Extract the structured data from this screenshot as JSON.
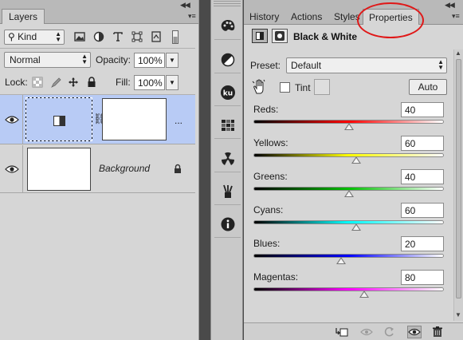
{
  "layers_panel": {
    "tab_label": "Layers",
    "collapse_glyph": "◀◀",
    "menu_glyph": "▾≡",
    "filter": {
      "label": "Kind",
      "icons": [
        "image-filter-icon",
        "adjustment-filter-icon",
        "type-filter-icon",
        "shape-filter-icon",
        "smart-object-filter-icon",
        "filter-toggle-icon"
      ]
    },
    "blend_mode": "Normal",
    "opacity_label": "Opacity:",
    "opacity_value": "100%",
    "lock_label": "Lock:",
    "lock_icons": [
      "lock-transparent-icon",
      "lock-image-icon",
      "lock-position-icon",
      "lock-all-icon"
    ],
    "fill_label": "Fill:",
    "fill_value": "100%",
    "layers": [
      {
        "name": "",
        "type": "adjustment",
        "selected": true,
        "visible": true,
        "more": "..."
      },
      {
        "name": "Background",
        "type": "background",
        "selected": false,
        "visible": true,
        "locked": true
      }
    ]
  },
  "dock": {
    "buttons": [
      "paint-palette-icon",
      "adjustments-icon",
      "kuler-icon",
      "swatches-grid-icon",
      "styles-icon",
      "tool-presets-icon",
      "info-icon"
    ]
  },
  "properties_panel": {
    "tabs": [
      {
        "label": "History",
        "active": false
      },
      {
        "label": "Actions",
        "active": false
      },
      {
        "label": "Styles",
        "active": false
      },
      {
        "label": "Properties",
        "active": true
      }
    ],
    "collapse_glyph": "◀◀",
    "menu_glyph": "▾≡",
    "adjustment_title": "Black & White",
    "preset_label": "Preset:",
    "preset_value": "Default",
    "tint_label": "Tint",
    "tint_checked": false,
    "auto_label": "Auto",
    "sliders": [
      {
        "label": "Reds:",
        "value": "40",
        "colors": [
          "#000000",
          "#ff0000",
          "#ffffff"
        ],
        "thumb": 0.5
      },
      {
        "label": "Yellows:",
        "value": "60",
        "colors": [
          "#000000",
          "#ffff00",
          "#ffffff"
        ],
        "thumb": 0.54
      },
      {
        "label": "Greens:",
        "value": "40",
        "colors": [
          "#000000",
          "#00c000",
          "#ffffff"
        ],
        "thumb": 0.5
      },
      {
        "label": "Cyans:",
        "value": "60",
        "colors": [
          "#000000",
          "#00ffff",
          "#ffffff"
        ],
        "thumb": 0.54
      },
      {
        "label": "Blues:",
        "value": "20",
        "colors": [
          "#000000",
          "#0000ff",
          "#ffffff"
        ],
        "thumb": 0.46
      },
      {
        "label": "Magentas:",
        "value": "80",
        "colors": [
          "#000000",
          "#ff00ff",
          "#ffffff"
        ],
        "thumb": 0.58
      }
    ],
    "bottom_icons": [
      "clip-to-layer-icon",
      "view-previous-icon",
      "reset-icon",
      "visibility-icon",
      "delete-icon"
    ],
    "highlight_color": "#e01818"
  }
}
